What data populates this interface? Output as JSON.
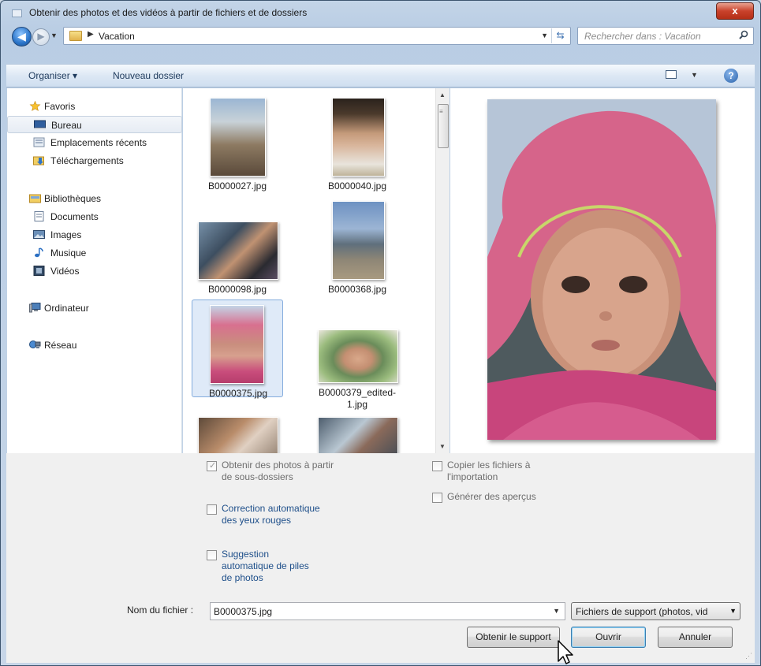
{
  "window": {
    "title": "Obtenir des photos et des vidéos à partir de fichiers et de dossiers",
    "close_label": "x"
  },
  "navigation": {
    "breadcrumb_folder": "Vacation",
    "search_placeholder": "Rechercher dans : Vacation"
  },
  "toolbar": {
    "organize_label": "Organiser ▾",
    "new_folder_label": "Nouveau dossier",
    "help_label": "?"
  },
  "sidebar": {
    "favorites": "Favoris",
    "desktop": "Bureau",
    "recent": "Emplacements récents",
    "downloads": "Téléchargements",
    "libraries": "Bibliothèques",
    "documents": "Documents",
    "images": "Images",
    "music": "Musique",
    "videos": "Vidéos",
    "computer": "Ordinateur",
    "network": "Réseau"
  },
  "files": [
    {
      "name": "B0000027.jpg"
    },
    {
      "name": "B0000040.jpg"
    },
    {
      "name": "B0000098.jpg"
    },
    {
      "name": "B0000368.jpg"
    },
    {
      "name": "B0000375.jpg",
      "selected": true
    },
    {
      "name": "B0000379_edited-1.jpg"
    }
  ],
  "options": {
    "subfolders": {
      "label": "Obtenir des photos à partir de sous-dossiers",
      "checked": true,
      "enabled": false
    },
    "red_eye": {
      "label": "Correction automatique des yeux rouges",
      "checked": false
    },
    "stacks": {
      "label": "Suggestion automatique de piles de photos",
      "checked": false
    },
    "copy_files": {
      "label": "Copier les fichiers à l'importation",
      "checked": false,
      "enabled": false
    },
    "previews": {
      "label": "Générer des aperçus",
      "checked": false,
      "enabled": false
    }
  },
  "filename": {
    "label": "Nom du fichier :",
    "value": "B0000375.jpg"
  },
  "file_type": {
    "selected": "Fichiers de support (photos, vid"
  },
  "buttons": {
    "get_media": "Obtenir le support",
    "open": "Ouvrir",
    "cancel": "Annuler"
  }
}
